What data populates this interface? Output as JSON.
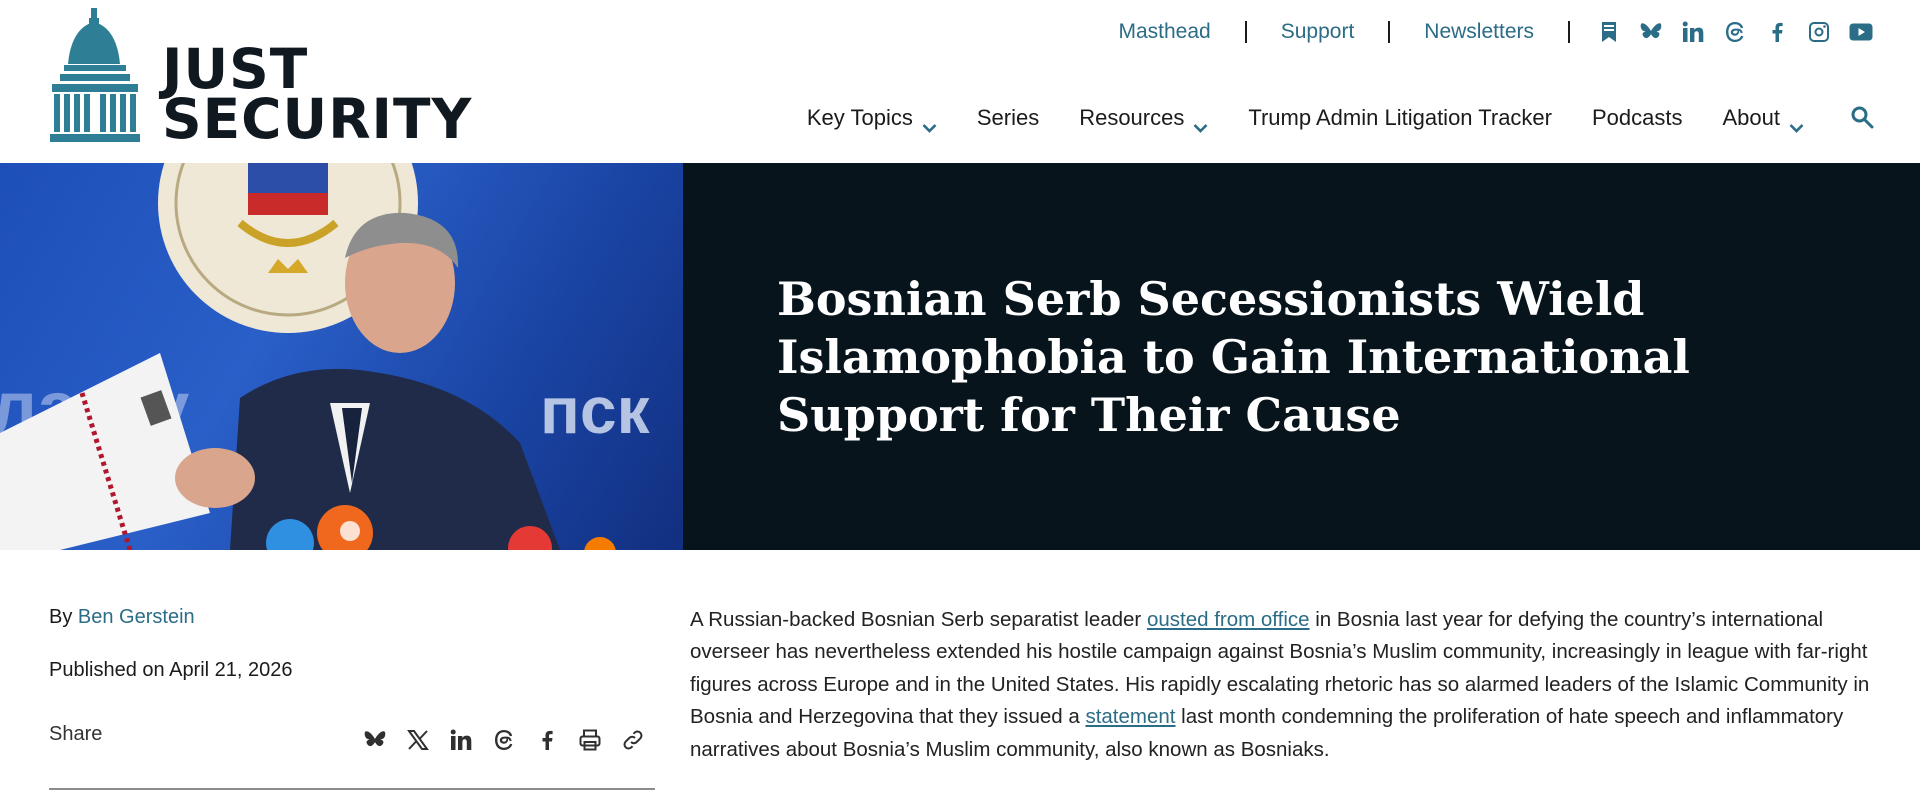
{
  "header": {
    "logo": {
      "line1": "JUST",
      "line2": "SECURITY"
    },
    "top_links": [
      "Masthead",
      "Support",
      "Newsletters"
    ],
    "social_icons": [
      "bookmark-icon",
      "bluesky-icon",
      "linkedin-icon",
      "threads-icon",
      "facebook-icon",
      "instagram-icon",
      "youtube-icon"
    ],
    "nav": {
      "key_topics": "Key Topics",
      "series": "Series",
      "resources": "Resources",
      "litigation_tracker": "Trump Admin Litigation Tracker",
      "podcasts": "Podcasts",
      "about": "About"
    }
  },
  "hero": {
    "title": "Bosnian Serb Secessionists Wield Islamophobia to Gain International Support for Their Cause"
  },
  "article": {
    "by": "By",
    "author": "Ben Gerstein",
    "published": "Published on April 21, 2026",
    "share_label": "Share",
    "share_icons": [
      "bluesky-icon",
      "x-icon",
      "linkedin-icon",
      "threads-icon",
      "facebook-icon",
      "print-icon",
      "link-icon"
    ],
    "body": {
      "p1": "A Russian-backed Bosnian Serb separatist leader ",
      "link1": "ousted from office",
      "p2": " in Bosnia last year for defying the country’s international overseer has nevertheless extended his hostile campaign against Bosnia’s Muslim community, increasingly in league with far-right figures across Europe and in the United States. His rapidly escalating rhetoric has so alarmed leaders of the Islamic Community in Bosnia and Herzegovina that they issued a ",
      "link2": "statement",
      "p3": " last month condemning the proliferation of hate speech and inflammatory narratives about Bosnia’s Muslim community, also known as Bosniaks."
    }
  },
  "colors": {
    "accent": "#2b6c86",
    "hero_bg": "#07141c",
    "text": "#1b1b1b"
  }
}
